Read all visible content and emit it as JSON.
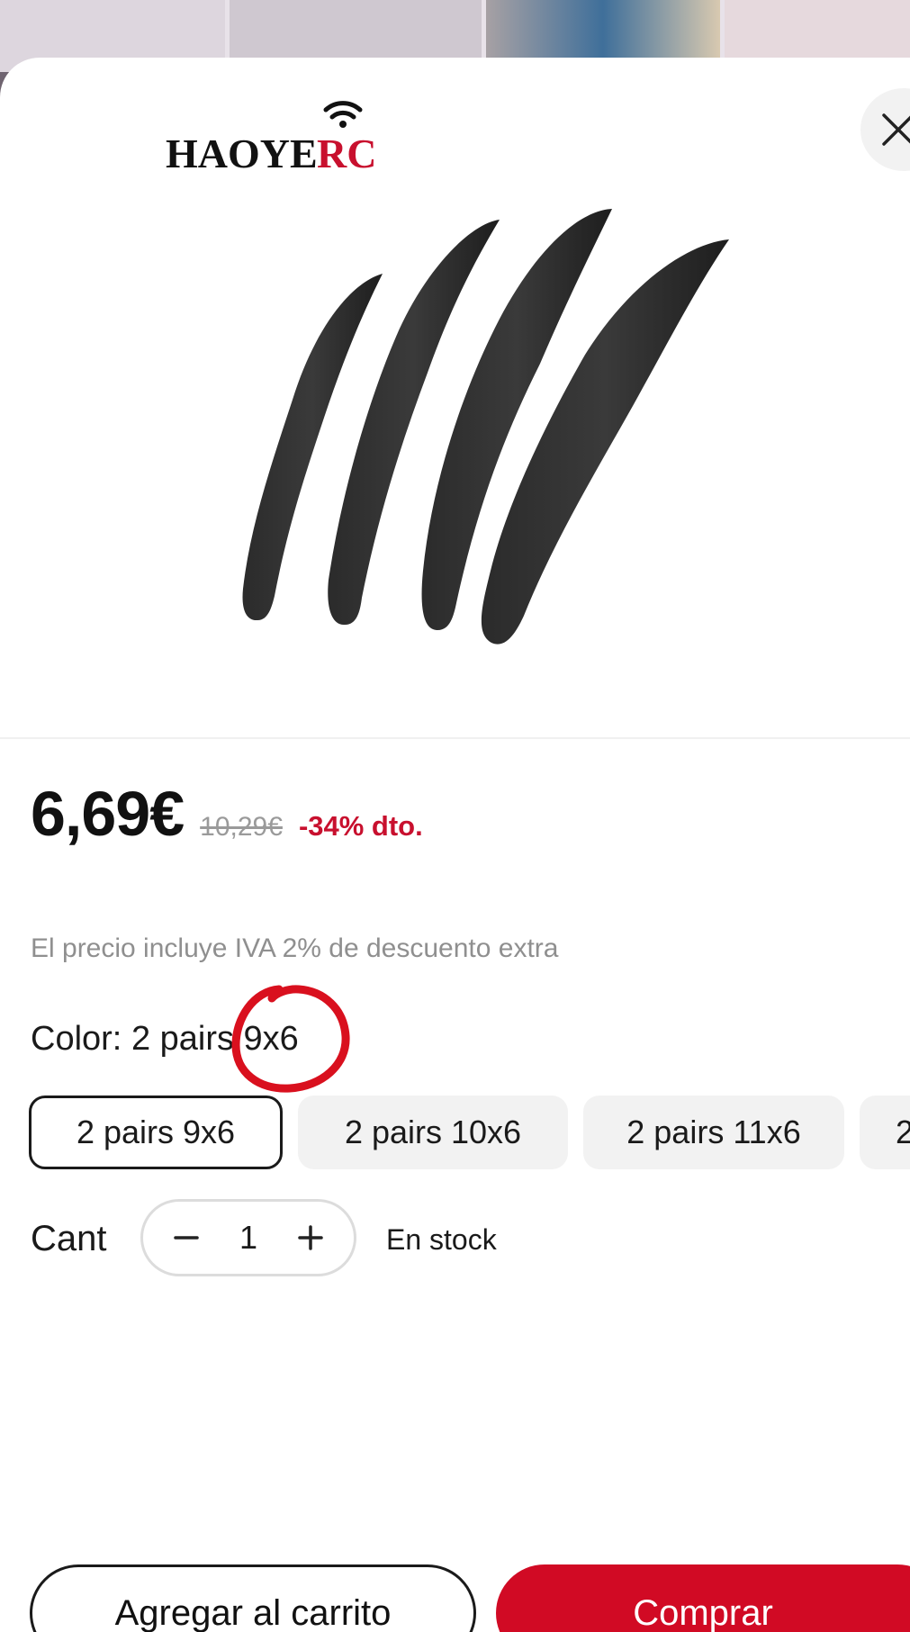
{
  "brand": {
    "logo_text_black": "HAOYE",
    "logo_text_red": "RC"
  },
  "product": {
    "price": "6,69€",
    "old_price": "10,29€",
    "discount": "-34% dto.",
    "tax_note": "El precio incluye IVA 2% de descuento extra"
  },
  "variant": {
    "label": "Color:",
    "selected_value": "2 pairs 9x6",
    "options": [
      {
        "label": "2 pairs 9x6",
        "selected": true
      },
      {
        "label": "2 pairs 10x6",
        "selected": false
      },
      {
        "label": "2 pairs 11x6",
        "selected": false
      },
      {
        "label": "2",
        "selected": false
      }
    ]
  },
  "quantity": {
    "label": "Cant",
    "value": "1",
    "stock": "En stock"
  },
  "actions": {
    "add_to_cart": "Agregar al carrito",
    "buy": "Comprar"
  },
  "icons": {
    "close": "close-icon",
    "minus": "minus-icon",
    "plus": "plus-icon",
    "wifi": "wifi-icon"
  },
  "colors": {
    "accent": "#d10a24",
    "discount": "#c8102e"
  }
}
